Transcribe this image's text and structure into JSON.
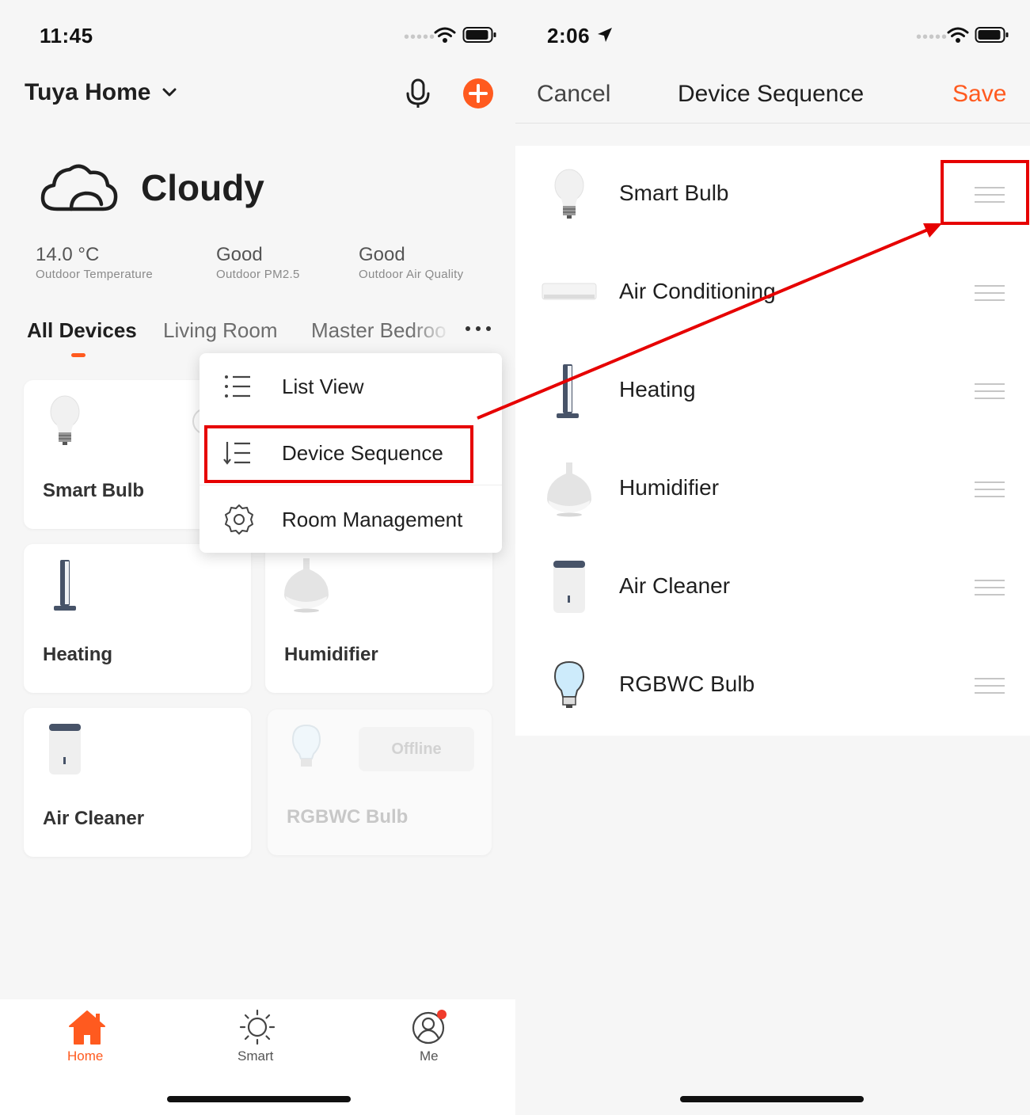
{
  "left": {
    "status_time": "11:45",
    "home_title": "Tuya Home",
    "weather": {
      "condition": "Cloudy",
      "stats": [
        {
          "value": "14.0 °C",
          "label": "Outdoor Temperature"
        },
        {
          "value": "Good",
          "label": "Outdoor PM2.5"
        },
        {
          "value": "Good",
          "label": "Outdoor Air Quality"
        }
      ]
    },
    "tabs": [
      "All Devices",
      "Living Room",
      "Master Bedroo"
    ],
    "devices": [
      {
        "name": "Smart Bulb"
      },
      {
        "name": "Heating"
      },
      {
        "name": "Humidifier"
      },
      {
        "name": "Air Cleaner"
      },
      {
        "name": "RGBWC Bulb",
        "status": "Offline"
      }
    ],
    "menu": [
      {
        "label": "List View",
        "icon": "list-view-icon"
      },
      {
        "label": "Device Sequence",
        "icon": "sort-icon"
      },
      {
        "label": "Room Management",
        "icon": "gear-icon"
      }
    ],
    "tabbar": [
      {
        "label": "Home",
        "icon": "home-icon",
        "active": true
      },
      {
        "label": "Smart",
        "icon": "sun-icon",
        "active": false
      },
      {
        "label": "Me",
        "icon": "profile-icon",
        "active": false
      }
    ]
  },
  "right": {
    "status_time": "2:06",
    "nav": {
      "cancel": "Cancel",
      "title": "Device Sequence",
      "save": "Save"
    },
    "devices": [
      {
        "name": "Smart Bulb"
      },
      {
        "name": "Air Conditioning"
      },
      {
        "name": "Heating"
      },
      {
        "name": "Humidifier"
      },
      {
        "name": "Air Cleaner"
      },
      {
        "name": "RGBWC Bulb"
      }
    ]
  },
  "colors": {
    "accent": "#ff5a1f",
    "annotation": "#e60000",
    "notification_dot": "#f03b2b"
  }
}
